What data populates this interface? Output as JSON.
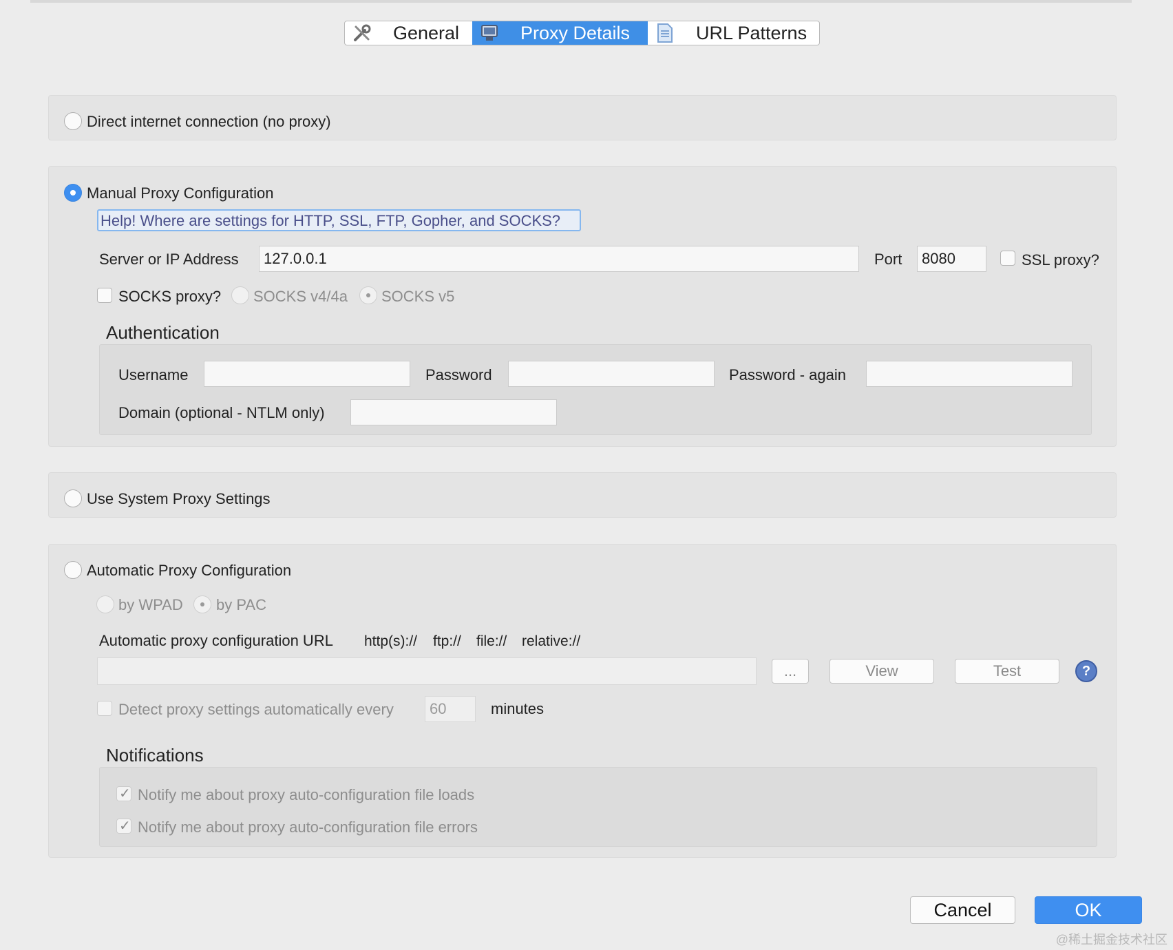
{
  "tabs": {
    "general": "General",
    "proxy_details": "Proxy Details",
    "url_patterns": "URL Patterns"
  },
  "direct": {
    "label": "Direct internet connection (no proxy)",
    "selected": false
  },
  "manual": {
    "label": "Manual Proxy Configuration",
    "selected": true,
    "help_link": "Help! Where are settings for HTTP, SSL, FTP, Gopher, and SOCKS?",
    "server_label": "Server or IP Address",
    "server_value": "127.0.0.1",
    "port_label": "Port",
    "port_value": "8080",
    "ssl_label": "SSL proxy?",
    "socks_label": "SOCKS proxy?",
    "socks_v4": "SOCKS v4/4a",
    "socks_v5": "SOCKS v5",
    "auth": {
      "heading": "Authentication",
      "username_label": "Username",
      "username_value": "",
      "password_label": "Password",
      "password_value": "",
      "password_again_label": "Password - again",
      "password_again_value": "",
      "domain_label": "Domain (optional - NTLM only)",
      "domain_value": ""
    }
  },
  "system": {
    "label": "Use System Proxy Settings",
    "selected": false
  },
  "automatic": {
    "label": "Automatic Proxy Configuration",
    "selected": false,
    "by_wpad": "by WPAD",
    "by_pac": "by PAC",
    "url_label": "Automatic proxy configuration URL",
    "schemes": [
      "http(s)://",
      "ftp://",
      "file://",
      "relative://"
    ],
    "url_value": "",
    "browse_button": "...",
    "view_button": "View",
    "test_button": "Test",
    "help_icon": "?",
    "detect_label": "Detect proxy settings automatically every",
    "detect_value": "60",
    "detect_unit": "minutes",
    "notifications": {
      "heading": "Notifications",
      "loads_label": "Notify me about proxy auto-configuration file loads",
      "loads_checked": true,
      "errors_label": "Notify me about proxy auto-configuration file errors",
      "errors_checked": true
    }
  },
  "footer": {
    "cancel": "Cancel",
    "ok": "OK"
  },
  "watermark": "@稀土掘金技术社区",
  "colors": {
    "accent": "#3f8fe6",
    "background": "#ececec"
  }
}
